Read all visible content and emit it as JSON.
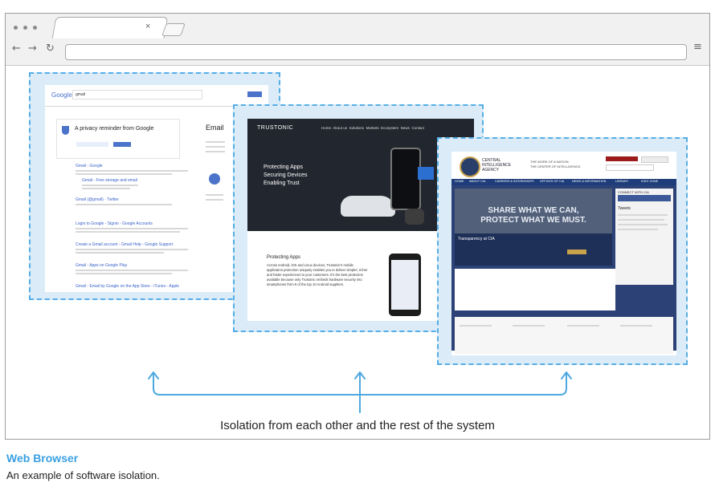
{
  "diagram": {
    "caption": "Isolation from each other and the rest of the system",
    "figure_title": "Web Browser",
    "figure_subtitle": "An example of software isolation."
  },
  "windows": {
    "google": {
      "logo": "Google",
      "query": "gmail",
      "reminder": "A privacy reminder from Google",
      "results": [
        "Gmail - Google",
        "Gmail - Free storage and email",
        "Gmail (@gmail) · Twitter",
        "Login to Google - Signin - Google Accounts",
        "Create a Gmail account - Gmail Help - Google Support",
        "Gmail - Apps on Google Play",
        "Gmail - Email by Google on the App Store - iTunes - Apple"
      ],
      "side_label": "Email"
    },
    "trustonic": {
      "logo": "TRUSTONIC",
      "nav": [
        "Home",
        "About us",
        "Solutions",
        "Markets",
        "Ecosystem",
        "News",
        "Contact"
      ],
      "hero": [
        "Protecting Apps",
        "Securing Devices",
        "Enabling Trust"
      ],
      "section_title": "Protecting Apps",
      "body": "Across Android, iOS and Linux devices, Trustonic's mobile application protection uniquely enables you to deliver simpler, richer and faster experiences to your customers. It's the best protection available because only Trustonic embeds hardware security into smartphones from 9 of the top 10 Android suppliers."
    },
    "cia": {
      "agency": [
        "CENTRAL",
        "INTELLIGENCE",
        "AGENCY"
      ],
      "tagline": [
        "THE WORK OF A NATION.",
        "THE CENTER OF INTELLIGENCE."
      ],
      "nav": [
        "HOME",
        "ABOUT CIA",
        "CAREERS & INTERNSHIPS",
        "OFFICES OF CIA",
        "NEWS & INFORMATION",
        "LIBRARY",
        "KIDS' ZONE"
      ],
      "banner": [
        "SHARE WHAT WE CAN,",
        "PROTECT WHAT WE MUST."
      ],
      "banner_caption": "Transparency at CIA",
      "connect": "CONNECT WITH CIA",
      "sidebar_title": "Tweets"
    }
  },
  "colors": {
    "dashed_border": "#55aee6",
    "highlight_fill": "#dbecf8",
    "arrow": "#4ea8e0",
    "title": "#3aa0e3"
  }
}
